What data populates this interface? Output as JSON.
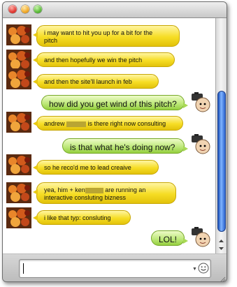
{
  "messages": [
    {
      "from": "them",
      "lines": [
        "i may want to hit you up for a bit for the",
        "pitch"
      ]
    },
    {
      "from": "them",
      "lines": [
        "and then hopefully we win the pitch"
      ]
    },
    {
      "from": "them",
      "lines": [
        "and then the site'll launch in feb"
      ]
    },
    {
      "from": "me",
      "lines": [
        "how did you get wind of this pitch?"
      ]
    },
    {
      "from": "them",
      "prefix": "andrew",
      "suffix": "is there right now consulting"
    },
    {
      "from": "me",
      "lines": [
        "is that what he's doing now?"
      ]
    },
    {
      "from": "them",
      "lines": [
        "so he reco'd me to lead creaive"
      ]
    },
    {
      "from": "them",
      "prefix": "yea, him + ken",
      "suffix": "are running an",
      "lines2": "interactive consluting bizness"
    },
    {
      "from": "them",
      "lines": [
        "i like that typ: consluting"
      ]
    },
    {
      "from": "me",
      "lines": [
        "LOL!"
      ]
    }
  ],
  "input": {
    "value": "",
    "placeholder": ""
  },
  "colors": {
    "them_bubble": "#f6dd24",
    "me_bubble": "#bfe97c",
    "scroll_thumb": "#2b63cf"
  },
  "icons": {
    "emoticon": "smiley-icon",
    "dropdown": "chevron-down-icon",
    "resize": "resize-grip-icon"
  }
}
